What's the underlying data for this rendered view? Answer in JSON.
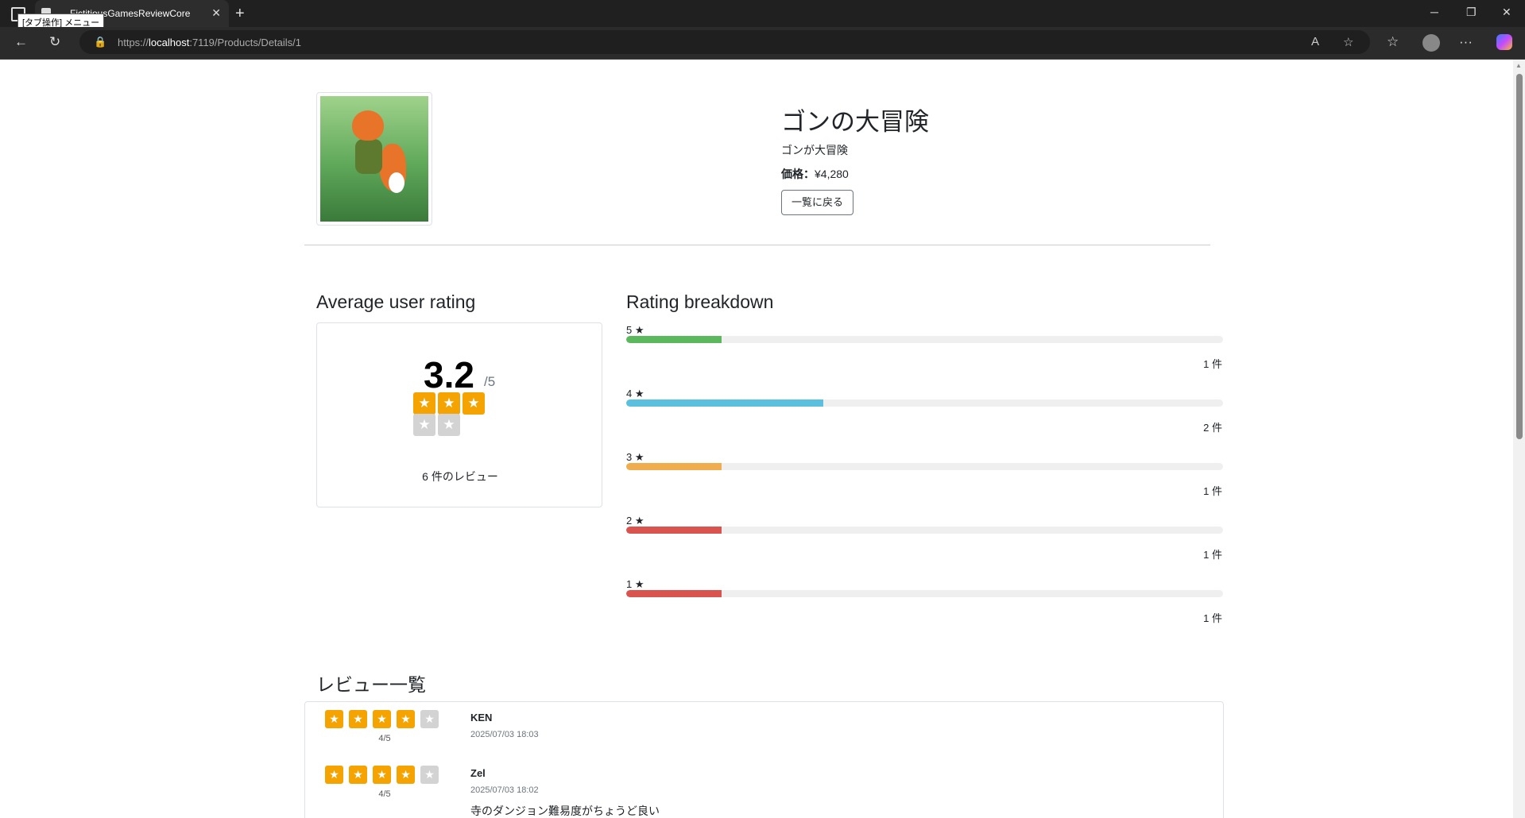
{
  "browser": {
    "tab_title": "FictitiousGamesReviewCore",
    "tooltip": "[タブ操作] メニュー",
    "url_scheme": "https://",
    "url_host": "localhost",
    "url_rest": ":7119/Products/Details/1"
  },
  "product": {
    "title": "ゴンの大冒険",
    "description": "ゴンが大冒険",
    "price_label": "価格：",
    "price_value": "¥4,280",
    "back_label": "一覧に戻る"
  },
  "average": {
    "heading": "Average user rating",
    "value": "3.2",
    "max": "/5",
    "stars_filled": 3,
    "stars_total": 5,
    "count_text": "6 件のレビュー"
  },
  "breakdown": {
    "heading": "Rating breakdown",
    "rows": [
      {
        "label": "5 ★",
        "count_text": "1 件",
        "fraction": 0.16,
        "color": "#5cb85c"
      },
      {
        "label": "4 ★",
        "count_text": "2 件",
        "fraction": 0.33,
        "color": "#5bc0de"
      },
      {
        "label": "3 ★",
        "count_text": "1 件",
        "fraction": 0.16,
        "color": "#f0ad4e"
      },
      {
        "label": "2 ★",
        "count_text": "1 件",
        "fraction": 0.16,
        "color": "#d9534f"
      },
      {
        "label": "1 ★",
        "count_text": "1 件",
        "fraction": 0.16,
        "color": "#d9534f"
      }
    ]
  },
  "reviews": {
    "heading": "レビュー一覧",
    "items": [
      {
        "name": "KEN",
        "date": "2025/07/03 18:03",
        "score_text": "4/5",
        "stars": 4,
        "comment": ""
      },
      {
        "name": "Zel",
        "date": "2025/07/03 18:02",
        "score_text": "4/5",
        "stars": 4,
        "comment": "寺のダンジョン難易度がちょうど良い"
      }
    ]
  },
  "colors": {
    "star_on": "#f5a300",
    "star_off": "#d3d3d3"
  }
}
